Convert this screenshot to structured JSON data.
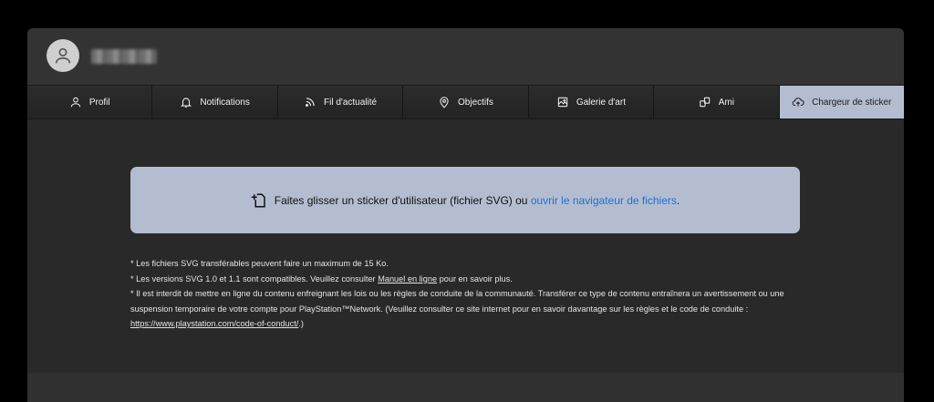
{
  "header": {
    "avatar_icon": "user-icon"
  },
  "tabs": [
    {
      "label": "Profil",
      "icon": "user-icon"
    },
    {
      "label": "Notifications",
      "icon": "bell-icon"
    },
    {
      "label": "Fil d'actualité",
      "icon": "rss-icon"
    },
    {
      "label": "Objectifs",
      "icon": "location-pin-icon"
    },
    {
      "label": "Galerie d'art",
      "icon": "gallery-icon"
    },
    {
      "label": "Ami",
      "icon": "friends-icon"
    },
    {
      "label": "Chargeur de sticker",
      "icon": "cloud-upload-icon",
      "active": true
    }
  ],
  "dropzone": {
    "text": "Faites glisser un sticker d'utilisateur (fichier SVG) ou ",
    "link": "ouvrir le navigateur de fichiers",
    "suffix": "."
  },
  "notes": {
    "line1": "* Les fichiers SVG transférables peuvent faire un maximum de 15 Ko.",
    "line2_pre": "* Les versions SVG 1.0 et 1.1 sont compatibles. Veuillez consulter ",
    "line2_link": "Manuel en ligne",
    "line2_post": " pour en savoir plus.",
    "line3_pre": "* Il est interdit de mettre en ligne du contenu enfreignant les lois ou les règles de conduite de la communauté. Transférer ce type de contenu entraînera un avertissement ou une suspension temporaire de votre compte pour PlayStation™Network. (Veuillez consulter ce site internet pour en savoir davantage sur les règles et le code de conduite : ",
    "line3_link": "https://www.playstation.com/code-of-conduct/",
    "line3_post": ".)"
  },
  "colors": {
    "panel": "#292929",
    "header": "#333333",
    "active_tab": "#b4bdd0",
    "link": "#1f6fd6"
  }
}
